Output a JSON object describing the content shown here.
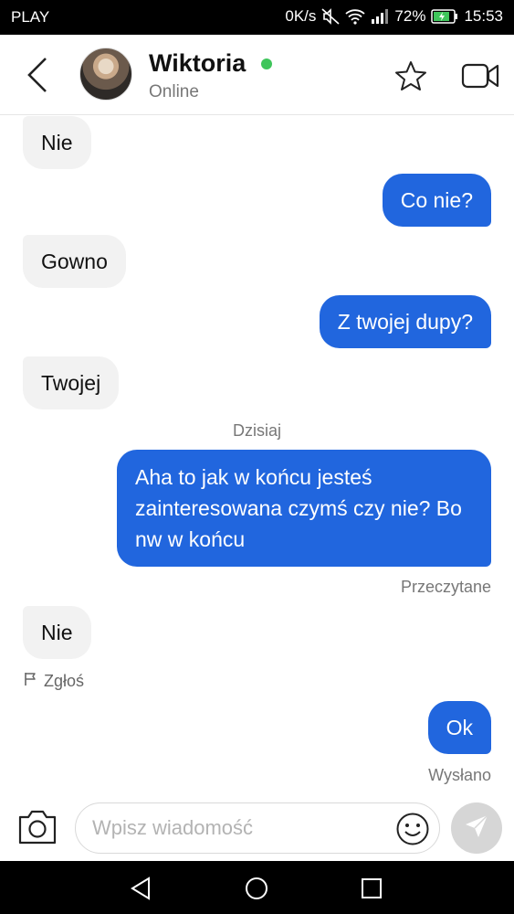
{
  "status_bar": {
    "carrier": "PLAY",
    "net_speed": "0K/s",
    "battery": "72%",
    "time": "15:53"
  },
  "header": {
    "contact_name": "Wiktoria",
    "status": "Online"
  },
  "messages": [
    {
      "text": "Nie"
    },
    {
      "text": "Co nie?"
    },
    {
      "text": "Gowno"
    },
    {
      "text": "Z twojej dupy?"
    },
    {
      "text": "Twojej"
    },
    {
      "text": "Aha to jak w końcu jesteś zainteresowana czymś czy nie? Bo nw w końcu"
    },
    {
      "text": "Nie"
    },
    {
      "text": "Ok"
    }
  ],
  "date_separator": "Dzisiaj",
  "read_receipt": "Przeczytane",
  "report_label": "Zgłoś",
  "sent_receipt": "Wysłano",
  "composer": {
    "placeholder": "Wpisz wiadomość"
  },
  "colors": {
    "outgoing": "#2166de",
    "incoming": "#f2f2f2",
    "online": "#3fc55b"
  }
}
